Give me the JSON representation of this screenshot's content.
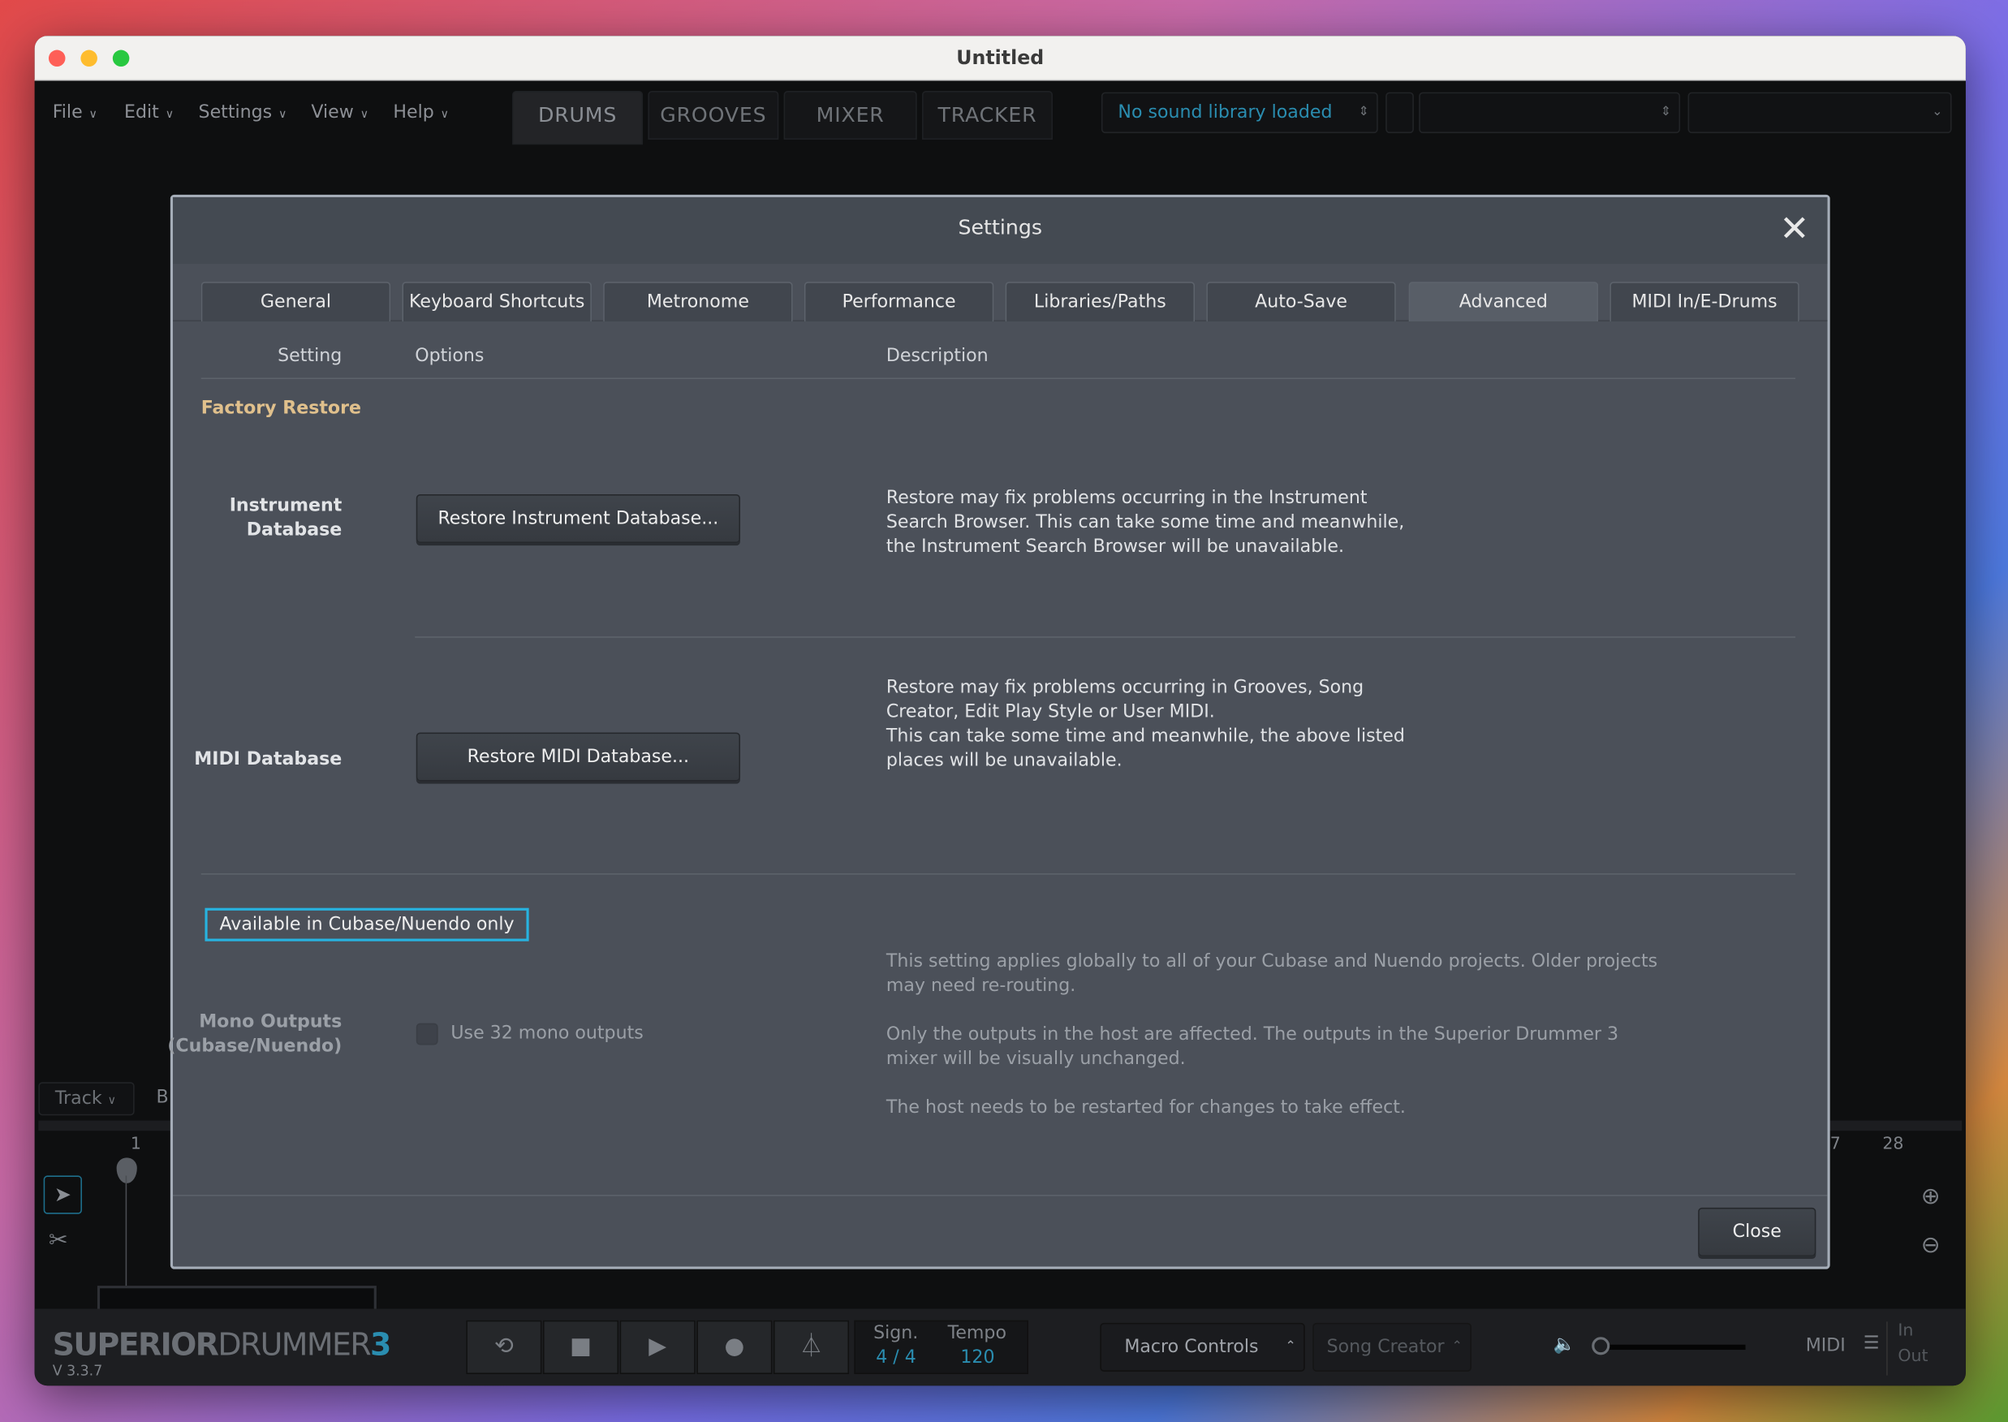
{
  "window": {
    "title": "Untitled"
  },
  "menu": [
    "File",
    "Edit",
    "Settings",
    "View",
    "Help"
  ],
  "main_tabs": [
    {
      "label": "DRUMS",
      "selected": true
    },
    {
      "label": "GROOVES"
    },
    {
      "label": "MIXER"
    },
    {
      "label": "TRACKER"
    }
  ],
  "library_dropdown": "No sound library loaded",
  "dialog": {
    "title": "Settings",
    "tabs": [
      "General",
      "Keyboard Shortcuts",
      "Metronome",
      "Performance",
      "Libraries/Paths",
      "Auto-Save",
      "Advanced",
      "MIDI In/E-Drums"
    ],
    "selected_tab": "Advanced",
    "headers": {
      "setting": "Setting",
      "options": "Options",
      "description": "Description"
    },
    "section": "Factory Restore",
    "instrument": {
      "label1": "Instrument",
      "label2": "Database",
      "button": "Restore Instrument Database...",
      "desc": [
        "Restore may fix problems occurring in the Instrument",
        "Search Browser. This can take some time and meanwhile,",
        "the Instrument Search Browser will be unavailable."
      ]
    },
    "midi": {
      "label": "MIDI Database",
      "button": "Restore MIDI Database...",
      "desc": [
        "Restore may fix problems occurring in Grooves, Song",
        "Creator, Edit Play Style or User MIDI.",
        "This can take some time and meanwhile, the above listed",
        "places will be unavailable."
      ]
    },
    "cubase_box": "Available in Cubase/Nuendo only",
    "mono": {
      "label1": "Mono Outputs",
      "label2": "(Cubase/Nuendo)",
      "checkbox": "Use 32 mono outputs",
      "checked": false,
      "desc": [
        "This setting applies globally to all of your Cubase and Nuendo projects. Older projects",
        "may need re-routing.",
        "Only the outputs in the host are affected. The outputs in the Superior Drummer 3",
        "mixer will be visually unchanged.",
        "The host needs to be restarted for changes to take effect."
      ]
    },
    "close": "Close"
  },
  "background": {
    "track": "Track",
    "b": "B",
    "ruler_start": "1",
    "ruler_end_a": "7",
    "ruler_end_b": "28"
  },
  "bottom": {
    "logo_a": "SUPERIOR",
    "logo_b": "DRUMMER",
    "logo_c": "3",
    "version": "V 3.3.7",
    "sign_label": "Sign.",
    "sign": "4 / 4",
    "tempo_label": "Tempo",
    "tempo": "120",
    "macro": "Macro Controls",
    "song_creator": "Song Creator",
    "midi": "MIDI",
    "in": "In",
    "out": "Out"
  },
  "colors": {
    "accent": "#2a8db0",
    "section": "#e0c08c",
    "dialog_bg": "#4b5059"
  }
}
